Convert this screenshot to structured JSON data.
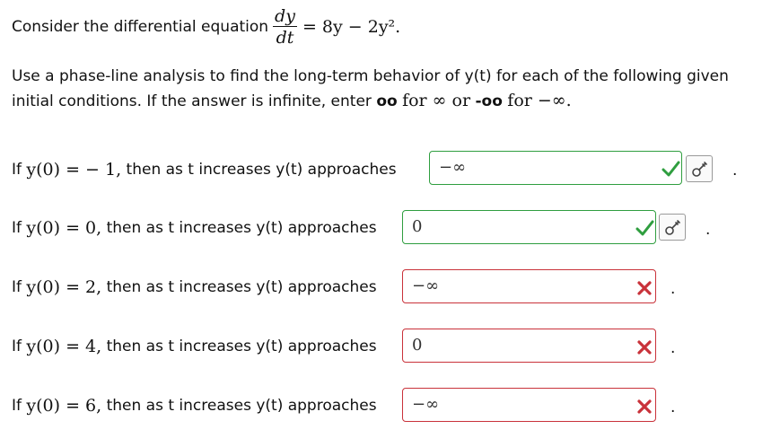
{
  "intro": {
    "prefix": "Consider the differential equation",
    "numerator": "dy",
    "denominator": "dt",
    "equation_rhs": "= 8y − 2y²."
  },
  "instructions": {
    "line1": "Use a phase-line analysis to find the long-term behavior of y(t) for each of the following given",
    "line2_part1": "initial conditions. If the answer is infinite, enter",
    "oo": "oo",
    "line2_part2": "for ∞ or",
    "neg_oo": "-oo",
    "line2_part3": "for −∞."
  },
  "rows": [
    {
      "prefix": "If",
      "condition": "y(0) = − 1,",
      "middle": "then as t increases y(t) approaches",
      "answer": "−∞",
      "status": "correct",
      "status_color": "#2f9e3f",
      "has_key_button": true,
      "suffix": "."
    },
    {
      "prefix": "If",
      "condition": "y(0) = 0,",
      "middle": "then as t increases y(t) approaches",
      "answer": "0",
      "status": "correct",
      "status_color": "#2f9e3f",
      "has_key_button": true,
      "suffix": "."
    },
    {
      "prefix": "If",
      "condition": "y(0) = 2,",
      "middle": "then as t increases y(t) approaches",
      "answer": "−∞",
      "status": "incorrect",
      "status_color": "#c9323a",
      "has_key_button": false,
      "suffix": "."
    },
    {
      "prefix": "If",
      "condition": "y(0) = 4,",
      "middle": "then as t increases y(t) approaches",
      "answer": "0",
      "status": "incorrect",
      "status_color": "#c9323a",
      "has_key_button": false,
      "suffix": "."
    },
    {
      "prefix": "If",
      "condition": "y(0) = 6,",
      "middle": "then as t increases y(t) approaches",
      "answer": "−∞",
      "status": "incorrect",
      "status_color": "#c9323a",
      "has_key_button": false,
      "suffix": "."
    }
  ],
  "icons": {
    "correct": "check-icon",
    "incorrect": "x-mark-icon",
    "key": "key-icon"
  }
}
